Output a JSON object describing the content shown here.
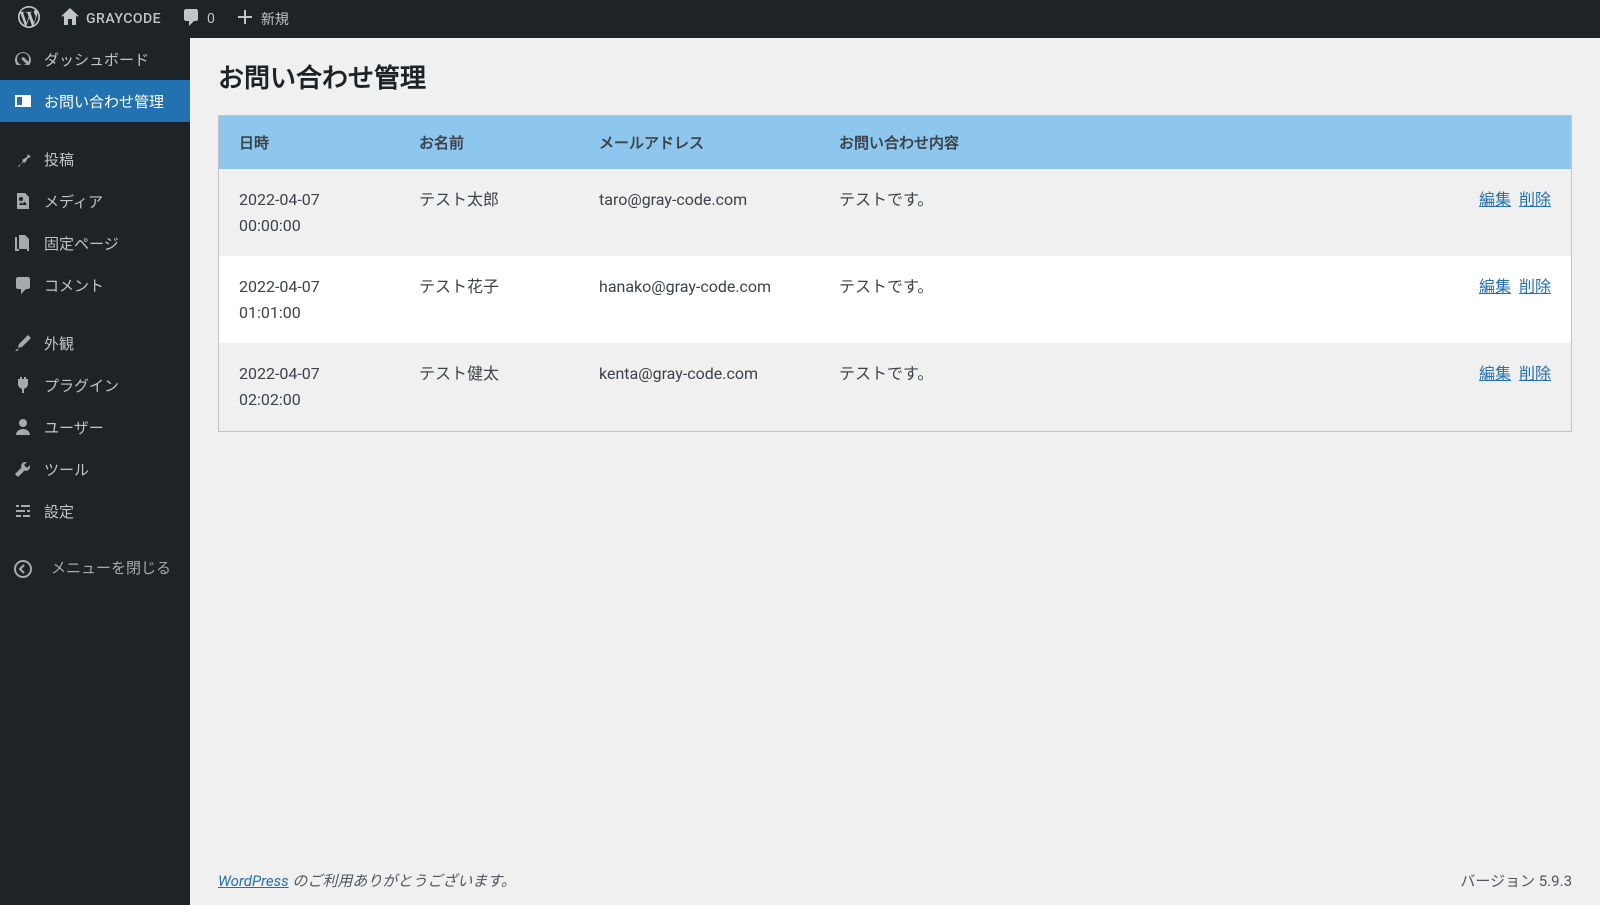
{
  "adminbar": {
    "site_name": "GRAYCODE",
    "comment_count": "0",
    "new_label": "新規"
  },
  "sidebar": {
    "dashboard": "ダッシュボード",
    "inquiries": "お問い合わせ管理",
    "posts": "投稿",
    "media": "メディア",
    "pages": "固定ページ",
    "comments": "コメント",
    "appearance": "外観",
    "plugins": "プラグイン",
    "users": "ユーザー",
    "tools": "ツール",
    "settings": "設定",
    "collapse": "メニューを閉じる"
  },
  "page": {
    "title": "お問い合わせ管理"
  },
  "table": {
    "headers": {
      "datetime": "日時",
      "name": "お名前",
      "email": "メールアドレス",
      "content": "お問い合わせ内容"
    },
    "actions": {
      "edit": "編集",
      "delete": "削除"
    },
    "rows": [
      {
        "datetime": "2022-04-07 00:00:00",
        "name": "テスト太郎",
        "email": "taro@gray-code.com",
        "content": "テストです。"
      },
      {
        "datetime": "2022-04-07 01:01:00",
        "name": "テスト花子",
        "email": "hanako@gray-code.com",
        "content": "テストです。"
      },
      {
        "datetime": "2022-04-07 02:02:00",
        "name": "テスト健太",
        "email": "kenta@gray-code.com",
        "content": "テストです。"
      }
    ]
  },
  "footer": {
    "link_text": "WordPress",
    "thanks": " のご利用ありがとうございます。",
    "version": "バージョン 5.9.3"
  }
}
